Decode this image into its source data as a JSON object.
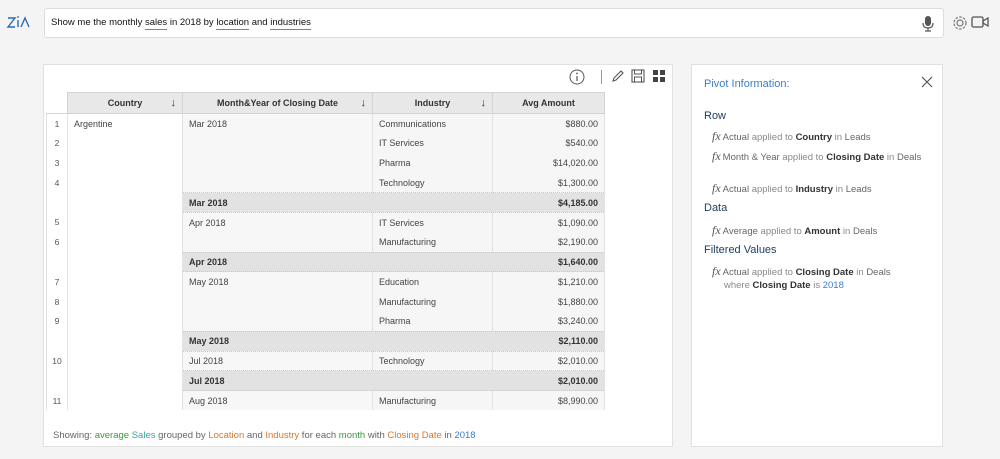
{
  "query": {
    "text_pre": "Show me the monthly ",
    "u1": "sales",
    "mid1": " in 2018 by ",
    "u2": "location",
    "mid2": " and ",
    "u3": "industries",
    "tail": ""
  },
  "table": {
    "headers": [
      "Country",
      "Month&Year of Closing Date",
      "Industry",
      "Avg Amount"
    ],
    "rows": [
      {
        "num": "1",
        "country": "Argentine",
        "month": "Mar 2018",
        "industry": "Communications",
        "amount": "$880.00"
      },
      {
        "num": "2",
        "country": "",
        "month": "",
        "industry": "IT Services",
        "amount": "$540.00"
      },
      {
        "num": "3",
        "country": "",
        "month": "",
        "industry": "Pharma",
        "amount": "$14,020.00"
      },
      {
        "num": "4",
        "country": "",
        "month": "",
        "industry": "Technology",
        "amount": "$1,300.00"
      },
      {
        "sub": true,
        "month": "Mar 2018",
        "amount": "$4,185.00"
      },
      {
        "num": "5",
        "country": "",
        "month": "Apr 2018",
        "industry": "IT Services",
        "amount": "$1,090.00"
      },
      {
        "num": "6",
        "country": "",
        "month": "",
        "industry": "Manufacturing",
        "amount": "$2,190.00"
      },
      {
        "sub": true,
        "month": "Apr 2018",
        "amount": "$1,640.00"
      },
      {
        "num": "7",
        "country": "",
        "month": "May 2018",
        "industry": "Education",
        "amount": "$1,210.00"
      },
      {
        "num": "8",
        "country": "",
        "month": "",
        "industry": "Manufacturing",
        "amount": "$1,880.00"
      },
      {
        "num": "9",
        "country": "",
        "month": "",
        "industry": "Pharma",
        "amount": "$3,240.00"
      },
      {
        "sub": true,
        "month": "May 2018",
        "amount": "$2,110.00"
      },
      {
        "num": "10",
        "country": "",
        "month": "Jul 2018",
        "industry": "Technology",
        "amount": "$2,010.00"
      },
      {
        "sub": true,
        "month": "Jul 2018",
        "amount": "$2,010.00"
      },
      {
        "num": "11",
        "country": "",
        "month": "Aug 2018",
        "industry": "Manufacturing",
        "amount": "$8,990.00"
      }
    ]
  },
  "showing": {
    "prefix": "Showing: ",
    "avg": "average",
    "sales": "Sales",
    "grouped": " grouped by ",
    "location": "Location",
    "and": " and ",
    "industry": "Industry",
    "foreach": " for each ",
    "month": "month",
    "with": " with ",
    "closing": "Closing Date",
    "in": " in ",
    "year": "2018"
  },
  "pivot": {
    "title": "Pivot Information:",
    "row_label": "Row",
    "row_items": [
      {
        "a": "Actual",
        "b": " applied to ",
        "c": "Country",
        "d": " in ",
        "e": "Leads"
      },
      {
        "a": "Month & Year",
        "b": " applied to ",
        "c": "Closing Date",
        "d": " in ",
        "e": "Deals"
      },
      {
        "a": "Actual",
        "b": " applied to ",
        "c": "Industry",
        "d": " in ",
        "e": "Leads"
      }
    ],
    "data_label": "Data",
    "data_items": [
      {
        "a": "Average",
        "b": " applied to ",
        "c": "Amount",
        "d": " in ",
        "e": "Deals"
      }
    ],
    "filter_label": "Filtered Values",
    "filter_items": [
      {
        "a": "Actual",
        "b": " applied to ",
        "c": "Closing Date",
        "d": " in ",
        "e": "Deals",
        "f": "where ",
        "g": "Closing Date",
        "h": " is ",
        "i": "2018"
      }
    ]
  },
  "colors": {
    "accent": "#3a7ec9",
    "green": "#3a9a3a",
    "orange": "#d9772a"
  },
  "icons": [
    "zia-logo-icon",
    "mic-icon",
    "gear-icon",
    "video-icon",
    "info-icon",
    "edit-icon",
    "save-icon",
    "grid-icon",
    "close-icon",
    "sort-down-icon",
    "fx-icon"
  ]
}
